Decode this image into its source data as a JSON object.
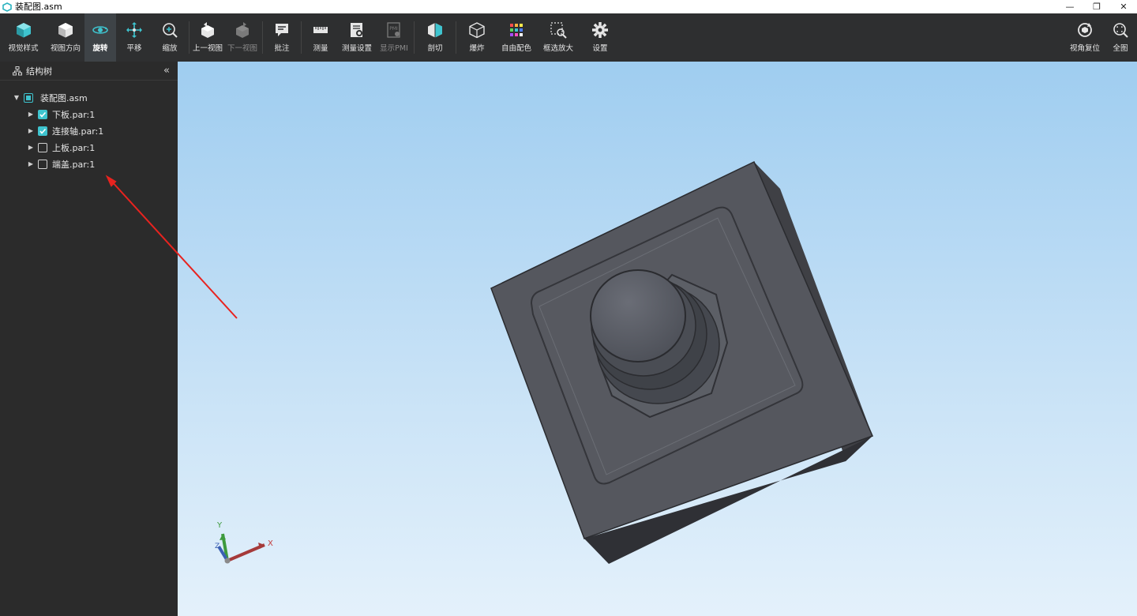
{
  "window": {
    "title": "装配图.asm",
    "minimize": "—",
    "restore": "❐",
    "close": "✕"
  },
  "toolbar": {
    "items": [
      {
        "label": "视觉样式",
        "icon": "cube-color-icon"
      },
      {
        "label": "视图方向",
        "icon": "cube-view-icon"
      },
      {
        "label": "旋转",
        "icon": "rotate-icon",
        "active": true
      },
      {
        "label": "平移",
        "icon": "pan-icon"
      },
      {
        "label": "缩放",
        "icon": "zoom-icon"
      },
      {
        "label": "上一视图",
        "icon": "prev-view-icon"
      },
      {
        "label": "下一视图",
        "icon": "next-view-icon",
        "disabled": true
      },
      {
        "label": "批注",
        "icon": "annotation-icon"
      },
      {
        "label": "测量",
        "icon": "ruler-icon"
      },
      {
        "label": "测量设置",
        "icon": "measure-settings-icon"
      },
      {
        "label": "显示PMI",
        "icon": "pmi-icon",
        "disabled": true
      },
      {
        "label": "剖切",
        "icon": "section-icon"
      },
      {
        "label": "爆炸",
        "icon": "explode-icon"
      },
      {
        "label": "自由配色",
        "icon": "palette-icon"
      },
      {
        "label": "框选放大",
        "icon": "box-zoom-icon"
      },
      {
        "label": "设置",
        "icon": "gear-icon"
      }
    ],
    "right_items": [
      {
        "label": "视角复位",
        "icon": "reset-view-icon"
      },
      {
        "label": "全图",
        "icon": "fit-all-icon"
      }
    ]
  },
  "sidebar": {
    "title": "结构树",
    "collapse": "«",
    "tree": {
      "root": {
        "label": "装配图.asm",
        "state": "partial"
      },
      "children": [
        {
          "label": "下板.par:1",
          "checked": true
        },
        {
          "label": "连接轴.par:1",
          "checked": true
        },
        {
          "label": "上板.par:1",
          "checked": false
        },
        {
          "label": "端盖.par:1",
          "checked": false
        }
      ]
    }
  },
  "triad": {
    "x": "X",
    "y": "Y",
    "z": "Z"
  },
  "colors": {
    "accent": "#3ec4cf",
    "toolbar_bg": "#2e2f30",
    "sidebar_bg": "#2b2b2b",
    "annotation_arrow": "#e8231f"
  }
}
